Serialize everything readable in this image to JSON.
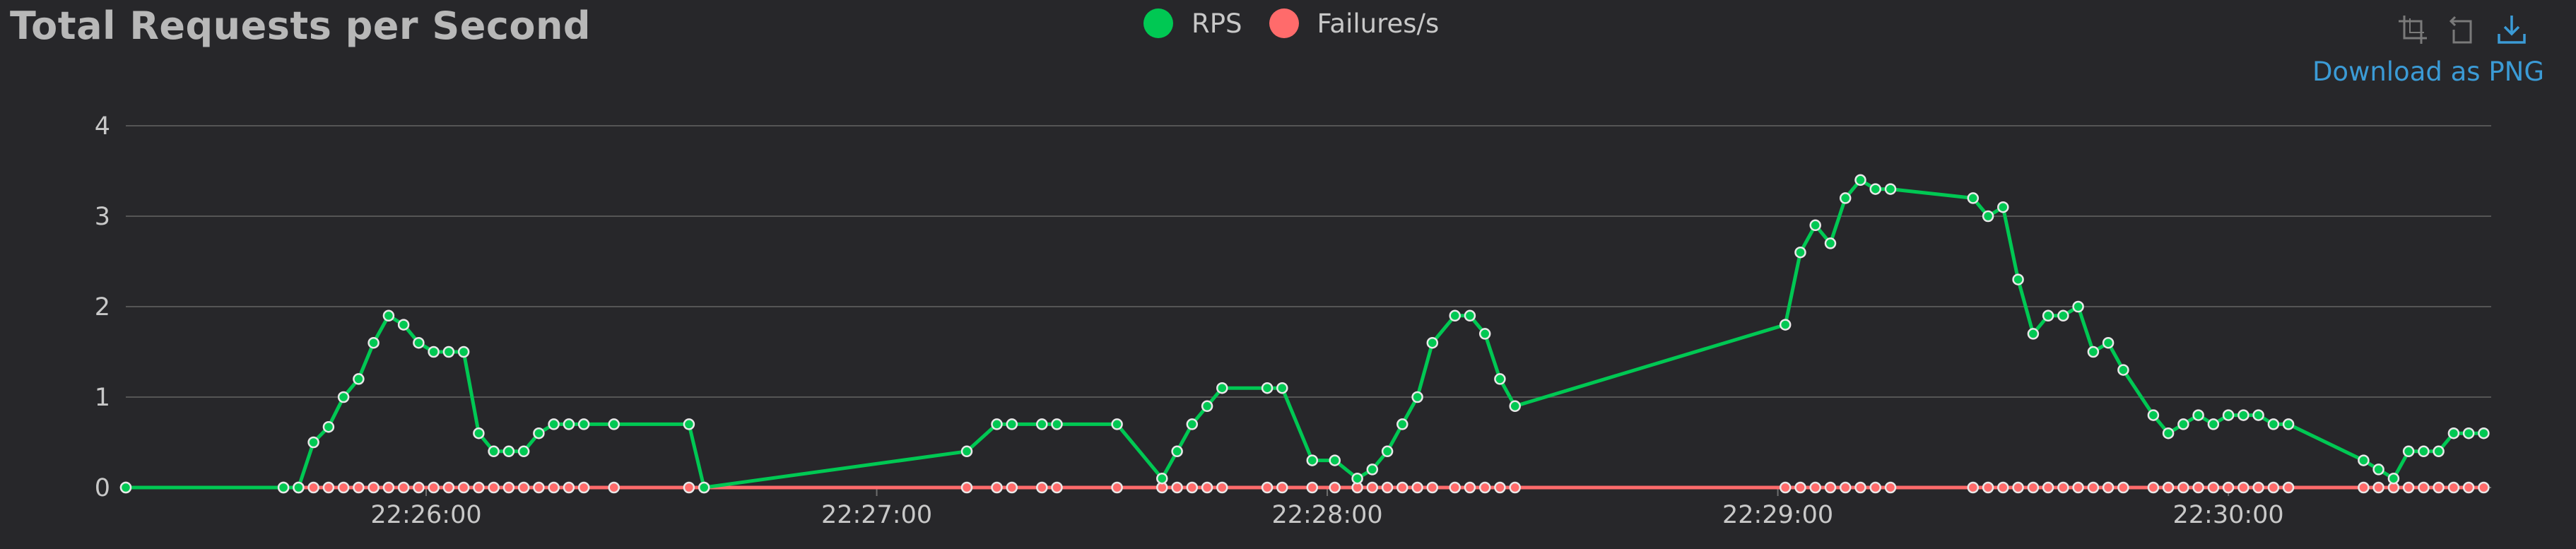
{
  "chart_title": "Total Requests per Second",
  "download_label": "Download as PNG",
  "toolbox": [
    {
      "name": "zoom-icon"
    },
    {
      "name": "zoom-reset-icon"
    },
    {
      "name": "download-icon"
    }
  ],
  "colors": {
    "background": "#27272a",
    "rps": "#00c853",
    "failures": "#ff6b6b",
    "grid": "#555555",
    "text": "#c8c8c8",
    "title": "#b8b8b8",
    "link": "#3b9bd6"
  },
  "chart_data": {
    "type": "line",
    "title": "Total Requests per Second",
    "xlabel": "",
    "ylabel": "",
    "ylim": [
      0,
      4
    ],
    "xlim": [
      "22:25:20",
      "22:30:35"
    ],
    "grid": true,
    "legend_position": "top-center",
    "y_ticks": [
      "0",
      "1",
      "2",
      "3",
      "4"
    ],
    "x_ticks": [
      "22:26:00",
      "22:27:00",
      "22:28:00",
      "22:29:00",
      "22:30:00"
    ],
    "series": [
      {
        "name": "RPS",
        "color": "#00c853",
        "points": [
          [
            "22:25:20",
            0
          ],
          [
            "22:25:41",
            0
          ],
          [
            "22:25:43",
            0
          ],
          [
            "22:25:45",
            0.5
          ],
          [
            "22:25:47",
            0.67
          ],
          [
            "22:25:49",
            1.0
          ],
          [
            "22:25:51",
            1.2
          ],
          [
            "22:25:53",
            1.6
          ],
          [
            "22:25:55",
            1.9
          ],
          [
            "22:25:57",
            1.8
          ],
          [
            "22:25:59",
            1.6
          ],
          [
            "22:26:01",
            1.5
          ],
          [
            "22:26:03",
            1.5
          ],
          [
            "22:26:05",
            1.5
          ],
          [
            "22:26:07",
            0.6
          ],
          [
            "22:26:09",
            0.4
          ],
          [
            "22:26:11",
            0.4
          ],
          [
            "22:26:13",
            0.4
          ],
          [
            "22:26:15",
            0.6
          ],
          [
            "22:26:17",
            0.7
          ],
          [
            "22:26:19",
            0.7
          ],
          [
            "22:26:21",
            0.7
          ],
          [
            "22:26:25",
            0.7
          ],
          [
            "22:26:35",
            0.7
          ],
          [
            "22:26:37",
            0.0
          ],
          [
            "22:27:12",
            0.4
          ],
          [
            "22:27:16",
            0.7
          ],
          [
            "22:27:18",
            0.7
          ],
          [
            "22:27:22",
            0.7
          ],
          [
            "22:27:24",
            0.7
          ],
          [
            "22:27:32",
            0.7
          ],
          [
            "22:27:38",
            0.1
          ],
          [
            "22:27:40",
            0.4
          ],
          [
            "22:27:42",
            0.7
          ],
          [
            "22:27:44",
            0.9
          ],
          [
            "22:27:46",
            1.1
          ],
          [
            "22:27:52",
            1.1
          ],
          [
            "22:27:54",
            1.1
          ],
          [
            "22:27:58",
            0.3
          ],
          [
            "22:28:01",
            0.3
          ],
          [
            "22:28:04",
            0.1
          ],
          [
            "22:28:06",
            0.2
          ],
          [
            "22:28:08",
            0.4
          ],
          [
            "22:28:10",
            0.7
          ],
          [
            "22:28:12",
            1.0
          ],
          [
            "22:28:14",
            1.6
          ],
          [
            "22:28:17",
            1.9
          ],
          [
            "22:28:19",
            1.9
          ],
          [
            "22:28:21",
            1.7
          ],
          [
            "22:28:23",
            1.2
          ],
          [
            "22:28:25",
            0.9
          ],
          [
            "22:29:01",
            1.8
          ],
          [
            "22:29:03",
            2.6
          ],
          [
            "22:29:05",
            2.9
          ],
          [
            "22:29:07",
            2.7
          ],
          [
            "22:29:09",
            3.2
          ],
          [
            "22:29:11",
            3.4
          ],
          [
            "22:29:13",
            3.3
          ],
          [
            "22:29:15",
            3.3
          ],
          [
            "22:29:26",
            3.2
          ],
          [
            "22:29:28",
            3.0
          ],
          [
            "22:29:30",
            3.1
          ],
          [
            "22:29:32",
            2.3
          ],
          [
            "22:29:34",
            1.7
          ],
          [
            "22:29:36",
            1.9
          ],
          [
            "22:29:38",
            1.9
          ],
          [
            "22:29:40",
            2.0
          ],
          [
            "22:29:42",
            1.5
          ],
          [
            "22:29:44",
            1.6
          ],
          [
            "22:29:46",
            1.3
          ],
          [
            "22:29:50",
            0.8
          ],
          [
            "22:29:52",
            0.6
          ],
          [
            "22:29:54",
            0.7
          ],
          [
            "22:29:56",
            0.8
          ],
          [
            "22:29:58",
            0.7
          ],
          [
            "22:30:00",
            0.8
          ],
          [
            "22:30:02",
            0.8
          ],
          [
            "22:30:04",
            0.8
          ],
          [
            "22:30:06",
            0.7
          ],
          [
            "22:30:08",
            0.7
          ],
          [
            "22:30:18",
            0.3
          ],
          [
            "22:30:20",
            0.2
          ],
          [
            "22:30:22",
            0.1
          ],
          [
            "22:30:24",
            0.4
          ],
          [
            "22:30:26",
            0.4
          ],
          [
            "22:30:28",
            0.4
          ],
          [
            "22:30:30",
            0.6
          ],
          [
            "22:30:32",
            0.6
          ],
          [
            "22:30:34",
            0.6
          ]
        ]
      },
      {
        "name": "Failures/s",
        "color": "#ff6b6b",
        "points": [
          [
            "22:25:20",
            0
          ],
          [
            "22:25:41",
            0
          ],
          [
            "22:25:43",
            0
          ],
          [
            "22:25:45",
            0
          ],
          [
            "22:25:47",
            0
          ],
          [
            "22:25:49",
            0
          ],
          [
            "22:25:51",
            0
          ],
          [
            "22:25:53",
            0
          ],
          [
            "22:25:55",
            0
          ],
          [
            "22:25:57",
            0
          ],
          [
            "22:25:59",
            0
          ],
          [
            "22:26:01",
            0
          ],
          [
            "22:26:03",
            0
          ],
          [
            "22:26:05",
            0
          ],
          [
            "22:26:07",
            0
          ],
          [
            "22:26:09",
            0
          ],
          [
            "22:26:11",
            0
          ],
          [
            "22:26:13",
            0
          ],
          [
            "22:26:15",
            0
          ],
          [
            "22:26:17",
            0
          ],
          [
            "22:26:19",
            0
          ],
          [
            "22:26:21",
            0
          ],
          [
            "22:26:25",
            0
          ],
          [
            "22:26:35",
            0
          ],
          [
            "22:26:37",
            0
          ],
          [
            "22:27:12",
            0
          ],
          [
            "22:27:16",
            0
          ],
          [
            "22:27:18",
            0
          ],
          [
            "22:27:22",
            0
          ],
          [
            "22:27:24",
            0
          ],
          [
            "22:27:32",
            0
          ],
          [
            "22:27:38",
            0
          ],
          [
            "22:27:40",
            0
          ],
          [
            "22:27:42",
            0
          ],
          [
            "22:27:44",
            0
          ],
          [
            "22:27:46",
            0
          ],
          [
            "22:27:52",
            0
          ],
          [
            "22:27:54",
            0
          ],
          [
            "22:27:58",
            0
          ],
          [
            "22:28:01",
            0
          ],
          [
            "22:28:04",
            0
          ],
          [
            "22:28:06",
            0
          ],
          [
            "22:28:08",
            0
          ],
          [
            "22:28:10",
            0
          ],
          [
            "22:28:12",
            0
          ],
          [
            "22:28:14",
            0
          ],
          [
            "22:28:17",
            0
          ],
          [
            "22:28:19",
            0
          ],
          [
            "22:28:21",
            0
          ],
          [
            "22:28:23",
            0
          ],
          [
            "22:28:25",
            0
          ],
          [
            "22:29:01",
            0
          ],
          [
            "22:29:03",
            0
          ],
          [
            "22:29:05",
            0
          ],
          [
            "22:29:07",
            0
          ],
          [
            "22:29:09",
            0
          ],
          [
            "22:29:11",
            0
          ],
          [
            "22:29:13",
            0
          ],
          [
            "22:29:15",
            0
          ],
          [
            "22:29:26",
            0
          ],
          [
            "22:29:28",
            0
          ],
          [
            "22:29:30",
            0
          ],
          [
            "22:29:32",
            0
          ],
          [
            "22:29:34",
            0
          ],
          [
            "22:29:36",
            0
          ],
          [
            "22:29:38",
            0
          ],
          [
            "22:29:40",
            0
          ],
          [
            "22:29:42",
            0
          ],
          [
            "22:29:44",
            0
          ],
          [
            "22:29:46",
            0
          ],
          [
            "22:29:50",
            0
          ],
          [
            "22:29:52",
            0
          ],
          [
            "22:29:54",
            0
          ],
          [
            "22:29:56",
            0
          ],
          [
            "22:29:58",
            0
          ],
          [
            "22:30:00",
            0
          ],
          [
            "22:30:02",
            0
          ],
          [
            "22:30:04",
            0
          ],
          [
            "22:30:06",
            0
          ],
          [
            "22:30:08",
            0
          ],
          [
            "22:30:18",
            0
          ],
          [
            "22:30:20",
            0
          ],
          [
            "22:30:22",
            0
          ],
          [
            "22:30:24",
            0
          ],
          [
            "22:30:26",
            0
          ],
          [
            "22:30:28",
            0
          ],
          [
            "22:30:30",
            0
          ],
          [
            "22:30:32",
            0
          ],
          [
            "22:30:34",
            0
          ]
        ]
      }
    ]
  }
}
